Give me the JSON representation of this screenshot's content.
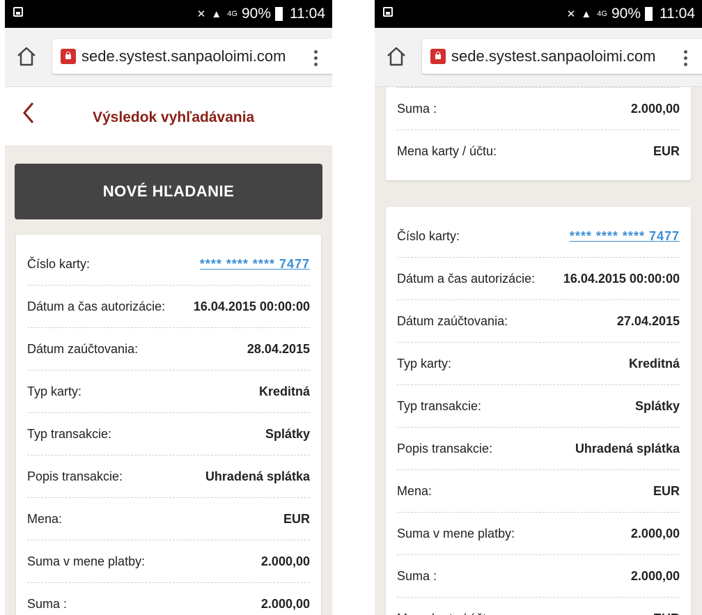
{
  "status_bar": {
    "battery": "90%",
    "time": "11:04",
    "network": "4G"
  },
  "browser": {
    "url": "sede.systest.sanpaoloimi.com"
  },
  "page": {
    "title": "Výsledok vyhľadávania",
    "new_search_label": "NOVÉ HĽADANIE"
  },
  "left_card": {
    "rows": [
      {
        "label": "Číslo karty:",
        "value": "**** **** **** 7477"
      },
      {
        "label": "Dátum a čas autorizácie:",
        "value": "16.04.2015 00:00:00"
      },
      {
        "label": "Dátum zaúčtovania:",
        "value": "28.04.2015"
      },
      {
        "label": "Typ karty:",
        "value": "Kreditná"
      },
      {
        "label": "Typ transakcie:",
        "value": "Splátky"
      },
      {
        "label": "Popis transakcie:",
        "value": "Uhradená splátka"
      },
      {
        "label": "Mena:",
        "value": "EUR"
      },
      {
        "label": "Suma v mene platby:",
        "value": "2.000,00"
      },
      {
        "label": "Suma :",
        "value": "2.000,00"
      }
    ]
  },
  "right_top_card": {
    "rows": [
      {
        "label": "Suma :",
        "value": "2.000,00"
      },
      {
        "label": "Mena karty / účtu:",
        "value": "EUR"
      }
    ]
  },
  "right_card": {
    "rows": [
      {
        "label": "Číslo karty:",
        "value": "**** **** **** 7477"
      },
      {
        "label": "Dátum a čas autorizácie:",
        "value": "16.04.2015 00:00:00"
      },
      {
        "label": "Dátum zaúčtovania:",
        "value": "27.04.2015"
      },
      {
        "label": "Typ karty:",
        "value": "Kreditná"
      },
      {
        "label": "Typ transakcie:",
        "value": "Splátky"
      },
      {
        "label": "Popis transakcie:",
        "value": "Uhradená splátka"
      },
      {
        "label": "Mena:",
        "value": "EUR"
      },
      {
        "label": "Suma v mene platby:",
        "value": "2.000,00"
      },
      {
        "label": "Suma :",
        "value": "2.000,00"
      },
      {
        "label": "Mena karty / účtu:",
        "value": "EUR"
      }
    ]
  },
  "colors": {
    "accent": "#8a1f16",
    "link": "#3a8ed6",
    "button": "#444444",
    "background": "#efebe7"
  }
}
